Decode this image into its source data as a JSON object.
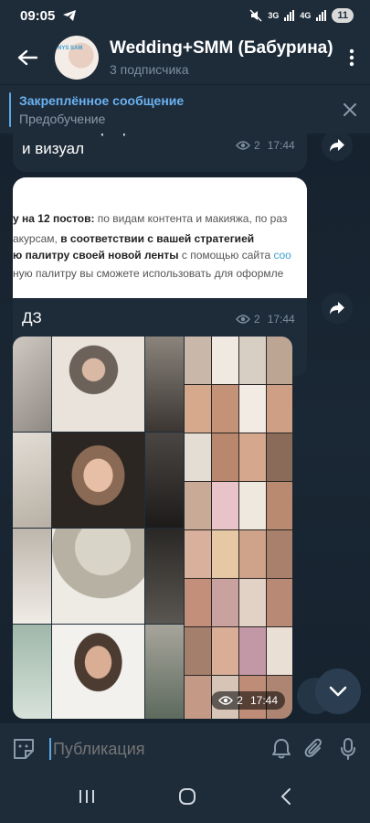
{
  "status_bar": {
    "time": "09:05",
    "network_3g": "3G",
    "network_4g": "4G",
    "battery": "11"
  },
  "header": {
    "title": "Wedding+SMM (Бабурина)",
    "subtitle": "3 подписчика",
    "avatar_text": "NYS SAM"
  },
  "pinned": {
    "title": "Закреплённое сообщение",
    "body": "Предобучение"
  },
  "messages": [
    {
      "text": "Упаковка профиля. Наполнение ленты и визуал",
      "views": "2",
      "time": "17:44"
    },
    {
      "doc_lines": [
        {
          "bold": "у на 12 постов:",
          "rest": " по видам контента и макияжа, по раз"
        },
        {
          "pre": "акурсам, ",
          "bold": "в соответствии с вашей стратегией"
        },
        {
          "bold": "ю палитру своей новой ленты",
          "rest": " с помощью сайта ",
          "link": "coo"
        },
        {
          "rest": "ную палитру вы сможете использовать для оформле"
        }
      ],
      "caption": "ДЗ",
      "views": "2",
      "time": "17:44"
    },
    {
      "views": "2",
      "time": "17:44"
    }
  ],
  "input": {
    "placeholder": "Публикация"
  },
  "colors": {
    "accent": "#6ab2f2",
    "header_bg": "#1e2c3a",
    "chat_bg": "#182533",
    "meta": "#7d8e9e"
  }
}
